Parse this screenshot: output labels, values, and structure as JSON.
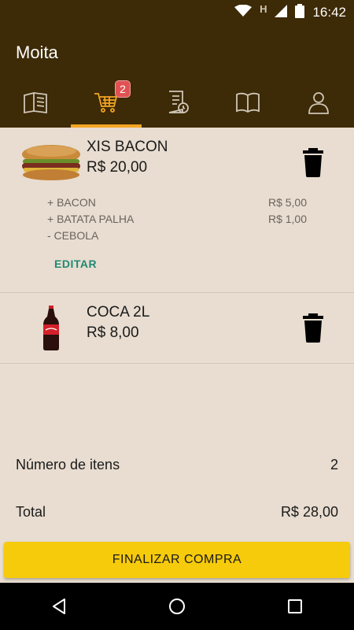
{
  "status_bar": {
    "time": "16:42",
    "network_letter": "H"
  },
  "app": {
    "title": "Moita"
  },
  "tabs": [
    {
      "icon": "menu-book-icon"
    },
    {
      "icon": "cart-icon",
      "badge": "2"
    },
    {
      "icon": "order-history-icon"
    },
    {
      "icon": "open-book-icon"
    },
    {
      "icon": "user-icon"
    }
  ],
  "cart": {
    "items": [
      {
        "name": "XIS BACON",
        "price": "R$ 20,00",
        "image": "burger-image",
        "extras": [
          {
            "label": "+ BACON",
            "price": "R$ 5,00"
          },
          {
            "label": "+ BATATA PALHA",
            "price": "R$ 1,00"
          },
          {
            "label": "- CEBOLA",
            "price": ""
          }
        ],
        "edit_label": "EDITAR"
      },
      {
        "name": "COCA 2L",
        "price": "R$ 8,00",
        "image": "cola-bottle-image"
      }
    ]
  },
  "summary": {
    "items_label": "Número de itens",
    "items_count": "2",
    "total_label": "Total",
    "total_value": "R$ 28,00"
  },
  "checkout_label": "FINALIZAR COMPRA",
  "colors": {
    "header": "#3d2a06",
    "accent": "#f4a523",
    "background": "#e8ddd0",
    "button": "#f6cb0b",
    "badge": "#e05252",
    "link": "#1f8a73"
  }
}
